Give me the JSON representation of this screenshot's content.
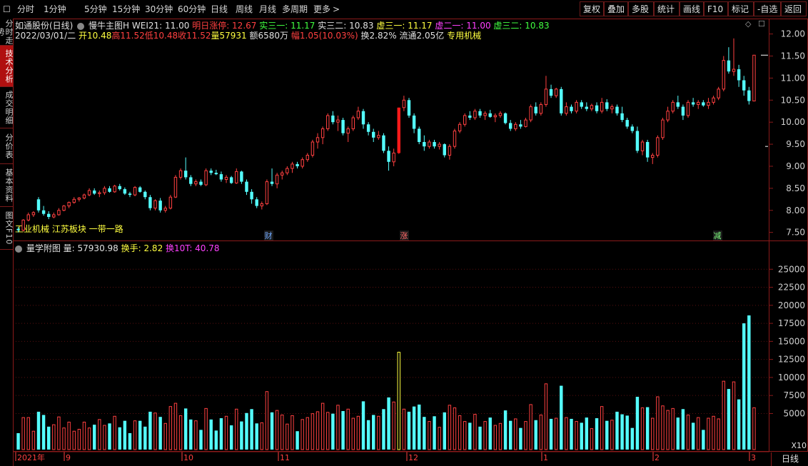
{
  "toolbar": {
    "periods": [
      "分时",
      "1分钟",
      "5分钟",
      "15分钟",
      "30分钟",
      "60分钟",
      "日线",
      "周线",
      "月线",
      "多周期",
      "更多"
    ],
    "more_arrow": ">",
    "right_buttons": [
      "复权",
      "叠加",
      "多股",
      "统计",
      "画线",
      "F10",
      "标记",
      "-自选",
      "返回"
    ]
  },
  "left_tabs": [
    {
      "label": "分时走势",
      "active": false
    },
    {
      "label": "技术分析",
      "active": true
    },
    {
      "label": "成交明细",
      "active": false
    },
    {
      "label": "分价表",
      "active": false
    },
    {
      "label": "基本资料",
      "active": false
    },
    {
      "label": "图文F10",
      "active": false
    }
  ],
  "main_info": {
    "stock": "如通股份(日线)",
    "indicator": "慢牛主图H",
    "wei21": "WEI21: 11.00",
    "tomorrow_limit": "明日涨停: 12.67",
    "shi_san_yi": "实三一: 11.17",
    "shi_san_er": "实三二: 10.83",
    "xu_san_yi_a": "虚三一: 11.17",
    "xu_er_yi": "虚二一: 11.00",
    "xu_san_er": "虚三二: 10.83",
    "date": "2022/03/01/二",
    "open": "开10.48",
    "high": "高11.52",
    "low": "低10.48",
    "close": "收11.52",
    "volume": "量57931",
    "amount": "额6580万",
    "change": "幅1.05(10.03%)",
    "turnover": "换2.82%",
    "float": "流通2.05亿",
    "sector_tag": "专用机械",
    "tags_bottom": "工业机械 江苏板块 一带一路"
  },
  "price_axis": [
    "12.00",
    "11.50",
    "11.00",
    "10.50",
    "10.00",
    "9.50",
    "9.00",
    "8.50",
    "8.00",
    "7.50"
  ],
  "vol_info": {
    "name": "量学附图",
    "vol": "量: 57930.98",
    "turn": "换手: 2.82",
    "turn10": "换10T: 40.78"
  },
  "vol_axis": [
    "25000",
    "22500",
    "20000",
    "17500",
    "15000",
    "12500",
    "10000",
    "7500",
    "5000"
  ],
  "vol_unit": "X10",
  "markers": [
    {
      "label": "财",
      "color": "#6fa8ff"
    },
    {
      "label": "涨",
      "color": "#ff6a6a"
    },
    {
      "label": "减",
      "color": "#7fff7f"
    }
  ],
  "time_axis": [
    "2021年",
    "9",
    "10",
    "11",
    "12",
    "1",
    "2",
    "3"
  ],
  "bottom_right": "日线",
  "colors": {
    "up": "#ff4040",
    "down": "#54ffff",
    "limit": "#ff1a1a",
    "yellow": "#ffff40",
    "magenta": "#ff40ff",
    "grid": "#8b1a1a"
  },
  "chart_data": {
    "type": "candlestick",
    "candles": [
      [
        7.58,
        7.62,
        7.5,
        7.55
      ],
      [
        7.55,
        7.8,
        7.52,
        7.78
      ],
      [
        7.78,
        7.95,
        7.75,
        7.9
      ],
      [
        7.9,
        7.98,
        7.85,
        7.95
      ],
      [
        8.25,
        8.3,
        7.95,
        8.0
      ],
      [
        8.0,
        8.1,
        7.88,
        7.92
      ],
      [
        7.92,
        7.98,
        7.8,
        7.85
      ],
      [
        7.85,
        7.95,
        7.82,
        7.9
      ],
      [
        7.9,
        8.05,
        7.88,
        8.0
      ],
      [
        8.0,
        8.12,
        7.98,
        8.1
      ],
      [
        8.1,
        8.2,
        8.05,
        8.18
      ],
      [
        8.18,
        8.3,
        8.15,
        8.25
      ],
      [
        8.25,
        8.3,
        8.2,
        8.28
      ],
      [
        8.28,
        8.38,
        8.25,
        8.35
      ],
      [
        8.35,
        8.5,
        8.32,
        8.45
      ],
      [
        8.45,
        8.5,
        8.35,
        8.38
      ],
      [
        8.38,
        8.45,
        8.3,
        8.4
      ],
      [
        8.4,
        8.55,
        8.35,
        8.5
      ],
      [
        8.5,
        8.55,
        8.4,
        8.42
      ],
      [
        8.42,
        8.58,
        8.4,
        8.55
      ],
      [
        8.55,
        8.6,
        8.45,
        8.48
      ],
      [
        8.48,
        8.52,
        8.35,
        8.38
      ],
      [
        8.38,
        8.42,
        8.3,
        8.35
      ],
      [
        8.35,
        8.55,
        8.32,
        8.52
      ],
      [
        8.52,
        8.55,
        8.4,
        8.42
      ],
      [
        8.42,
        8.45,
        8.25,
        8.3
      ],
      [
        8.3,
        8.35,
        8.0,
        8.05
      ],
      [
        8.05,
        8.25,
        8.0,
        8.22
      ],
      [
        8.22,
        8.28,
        7.95,
        8.0
      ],
      [
        8.0,
        8.1,
        7.95,
        8.05
      ],
      [
        8.05,
        8.35,
        8.02,
        8.3
      ],
      [
        8.3,
        8.8,
        8.28,
        8.75
      ],
      [
        8.75,
        8.95,
        8.7,
        8.9
      ],
      [
        8.9,
        9.2,
        8.7,
        8.75
      ],
      [
        8.75,
        8.8,
        8.55,
        8.6
      ],
      [
        8.6,
        8.7,
        8.55,
        8.65
      ],
      [
        8.65,
        8.7,
        8.55,
        8.58
      ],
      [
        8.58,
        8.95,
        8.55,
        8.9
      ],
      [
        8.9,
        8.95,
        8.8,
        8.85
      ],
      [
        8.85,
        8.92,
        8.8,
        8.82
      ],
      [
        8.82,
        8.88,
        8.65,
        8.7
      ],
      [
        8.7,
        8.8,
        8.62,
        8.75
      ],
      [
        8.75,
        8.78,
        8.6,
        8.62
      ],
      [
        8.62,
        8.95,
        8.6,
        8.88
      ],
      [
        8.88,
        8.9,
        8.6,
        8.65
      ],
      [
        8.65,
        8.7,
        8.35,
        8.42
      ],
      [
        8.42,
        8.48,
        8.15,
        8.25
      ],
      [
        8.25,
        8.3,
        8.05,
        8.1
      ],
      [
        8.1,
        8.2,
        8.02,
        8.15
      ],
      [
        8.15,
        8.7,
        8.12,
        8.65
      ],
      [
        8.65,
        8.95,
        8.55,
        8.6
      ],
      [
        8.6,
        8.85,
        8.5,
        8.8
      ],
      [
        8.8,
        8.9,
        8.7,
        8.85
      ],
      [
        8.85,
        9.0,
        8.8,
        8.95
      ],
      [
        8.95,
        9.1,
        8.85,
        9.05
      ],
      [
        9.05,
        9.1,
        8.95,
        9.0
      ],
      [
        9.0,
        9.2,
        8.95,
        9.15
      ],
      [
        9.15,
        9.3,
        9.1,
        9.25
      ],
      [
        9.25,
        9.6,
        9.2,
        9.55
      ],
      [
        9.55,
        9.75,
        9.4,
        9.65
      ],
      [
        9.65,
        9.9,
        9.5,
        9.85
      ],
      [
        9.85,
        10.2,
        9.8,
        10.15
      ],
      [
        10.15,
        10.25,
        9.95,
        10.0
      ],
      [
        10.0,
        10.15,
        9.8,
        10.05
      ],
      [
        10.05,
        10.1,
        9.7,
        9.75
      ],
      [
        9.75,
        9.9,
        9.55,
        9.85
      ],
      [
        9.85,
        10.15,
        9.8,
        10.1
      ],
      [
        10.1,
        10.35,
        10.05,
        10.25
      ],
      [
        10.25,
        10.3,
        9.85,
        9.95
      ],
      [
        9.95,
        10.0,
        9.7,
        9.78
      ],
      [
        9.78,
        9.85,
        9.55,
        9.65
      ],
      [
        9.65,
        9.8,
        9.6,
        9.7
      ],
      [
        9.7,
        9.75,
        9.3,
        9.35
      ],
      [
        9.35,
        9.45,
        8.9,
        9.1
      ],
      [
        9.1,
        9.4,
        9.0,
        9.3
      ],
      [
        9.3,
        10.33,
        9.28,
        10.33
      ],
      [
        10.33,
        10.6,
        10.25,
        10.5
      ],
      [
        10.5,
        10.55,
        10.1,
        10.15
      ],
      [
        10.15,
        10.2,
        9.75,
        9.85
      ],
      [
        9.85,
        9.9,
        9.5,
        9.55
      ],
      [
        9.55,
        9.7,
        9.35,
        9.45
      ],
      [
        9.45,
        9.6,
        9.4,
        9.55
      ],
      [
        9.55,
        9.6,
        9.4,
        9.45
      ],
      [
        9.45,
        9.55,
        9.38,
        9.5
      ],
      [
        9.5,
        9.52,
        9.2,
        9.25
      ],
      [
        9.25,
        9.5,
        9.15,
        9.45
      ],
      [
        9.45,
        9.85,
        9.4,
        9.8
      ],
      [
        9.8,
        10.0,
        9.75,
        9.95
      ],
      [
        9.95,
        10.2,
        9.9,
        10.15
      ],
      [
        10.15,
        10.25,
        10.05,
        10.1
      ],
      [
        10.1,
        10.3,
        10.05,
        10.25
      ],
      [
        10.25,
        10.3,
        10.1,
        10.15
      ],
      [
        10.15,
        10.25,
        10.05,
        10.2
      ],
      [
        10.2,
        10.28,
        10.1,
        10.12
      ],
      [
        10.12,
        10.2,
        10.0,
        10.15
      ],
      [
        10.15,
        10.25,
        10.1,
        10.2
      ],
      [
        10.2,
        10.22,
        9.95,
        9.98
      ],
      [
        9.98,
        10.05,
        9.8,
        9.85
      ],
      [
        9.85,
        10.0,
        9.8,
        9.95
      ],
      [
        9.95,
        10.05,
        9.85,
        9.9
      ],
      [
        9.9,
        10.1,
        9.88,
        10.05
      ],
      [
        10.05,
        10.4,
        10.0,
        10.35
      ],
      [
        10.35,
        10.45,
        10.15,
        10.2
      ],
      [
        10.2,
        10.45,
        10.15,
        10.4
      ],
      [
        10.4,
        11.05,
        10.35,
        10.75
      ],
      [
        10.75,
        10.85,
        10.55,
        10.6
      ],
      [
        10.6,
        10.78,
        10.55,
        10.75
      ],
      [
        10.75,
        10.8,
        10.15,
        10.2
      ],
      [
        10.2,
        10.45,
        10.15,
        10.35
      ],
      [
        10.35,
        10.4,
        10.2,
        10.25
      ],
      [
        10.25,
        10.5,
        10.2,
        10.45
      ],
      [
        10.45,
        10.5,
        10.3,
        10.35
      ],
      [
        10.35,
        10.45,
        10.25,
        10.3
      ],
      [
        10.3,
        10.42,
        10.25,
        10.38
      ],
      [
        10.38,
        10.45,
        10.2,
        10.25
      ],
      [
        10.25,
        10.55,
        10.2,
        10.45
      ],
      [
        10.45,
        10.52,
        10.25,
        10.3
      ],
      [
        10.3,
        10.4,
        10.2,
        10.35
      ],
      [
        10.35,
        10.4,
        10.15,
        10.2
      ],
      [
        10.2,
        10.35,
        10.0,
        10.05
      ],
      [
        10.05,
        10.1,
        9.85,
        9.9
      ],
      [
        9.9,
        9.95,
        9.75,
        9.8
      ],
      [
        9.8,
        9.9,
        9.3,
        9.35
      ],
      [
        9.35,
        9.6,
        9.25,
        9.55
      ],
      [
        9.55,
        9.6,
        9.1,
        9.2
      ],
      [
        9.2,
        9.3,
        9.05,
        9.25
      ],
      [
        9.25,
        9.7,
        9.2,
        9.65
      ],
      [
        9.65,
        10.1,
        9.6,
        10.05
      ],
      [
        10.05,
        10.35,
        10.0,
        10.25
      ],
      [
        10.25,
        10.5,
        10.2,
        10.45
      ],
      [
        10.45,
        10.6,
        10.3,
        10.35
      ],
      [
        10.35,
        10.4,
        10.05,
        10.15
      ],
      [
        10.15,
        10.5,
        10.1,
        10.45
      ],
      [
        10.45,
        10.55,
        10.35,
        10.4
      ],
      [
        10.4,
        10.5,
        10.3,
        10.45
      ],
      [
        10.45,
        10.5,
        10.35,
        10.38
      ],
      [
        10.38,
        10.55,
        10.3,
        10.45
      ],
      [
        10.45,
        10.6,
        10.4,
        10.55
      ],
      [
        10.55,
        10.8,
        10.5,
        10.75
      ],
      [
        10.75,
        11.5,
        10.7,
        11.4
      ],
      [
        11.4,
        11.7,
        11.1,
        11.15
      ],
      [
        11.15,
        11.9,
        11.05,
        11.2
      ],
      [
        11.2,
        11.3,
        10.8,
        10.95
      ],
      [
        10.95,
        11.05,
        10.6,
        10.72
      ],
      [
        10.72,
        10.8,
        10.4,
        10.48
      ],
      [
        10.48,
        11.52,
        10.48,
        11.52
      ]
    ],
    "limit_up_indices": [
      75,
      146,
      149
    ]
  }
}
